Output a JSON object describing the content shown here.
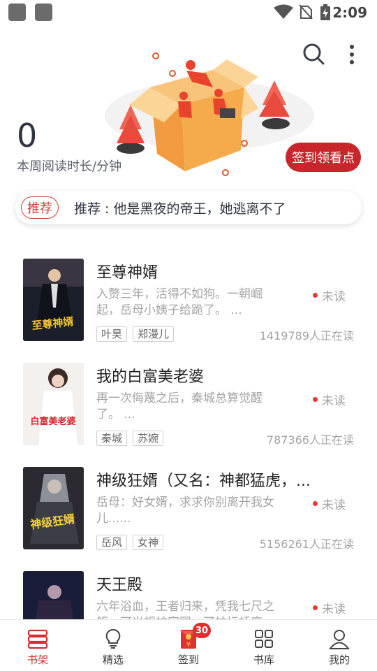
{
  "status_bar": {
    "time": "2:09"
  },
  "header": {
    "stat_value": "0",
    "stat_label": "本周阅读时长/分钟",
    "sign_button": "签到领看点"
  },
  "recommend": {
    "tag": "推荐",
    "text": "推荐 : 他是黑夜的帝王，她逃离不了"
  },
  "books": [
    {
      "title": "至尊神婿",
      "desc": "入赘三年，活得不如狗。一朝崛起，岳母小姨子给跪了。 ...",
      "status": "未读",
      "tags": [
        "叶昊",
        "郑漫儿"
      ],
      "readers": "1419789人正在读",
      "cover_text": "至尊神婿",
      "cover_bg": "#1b1f2a"
    },
    {
      "title": "我的白富美老婆",
      "desc": "再一次侮蔑之后，秦城总算觉醒了。 ...",
      "status": "未读",
      "tags": [
        "秦城",
        "苏婉"
      ],
      "readers": "787366人正在读",
      "cover_text": "白富美老婆",
      "cover_bg": "#f4f0ee"
    },
    {
      "title": "神级狂婿（又名：神都猛虎，...",
      "desc": "岳母：好女婿，求求你别离开我女儿......",
      "status": "未读",
      "tags": [
        "岳风",
        "女神"
      ],
      "readers": "5156261人正在读",
      "cover_text": "神级狂婿",
      "cover_bg": "#2a2a30"
    },
    {
      "title": "天王殿",
      "desc": "六年浴血，王者归来，凭我七尺之躯，可当规护家国，可护坛桥度。",
      "status": "未读",
      "tags": [],
      "readers": "",
      "cover_text": "",
      "cover_bg": "#1a1d3a"
    }
  ],
  "nav": [
    {
      "label": "书架",
      "icon": "bookshelf-icon",
      "active": true
    },
    {
      "label": "精选",
      "icon": "lightbulb-icon",
      "active": false
    },
    {
      "label": "签到",
      "icon": "red-envelope-icon",
      "active": false,
      "badge": "30"
    },
    {
      "label": "书库",
      "icon": "grid-icon",
      "active": false
    },
    {
      "label": "我的",
      "icon": "person-icon",
      "active": false
    }
  ],
  "colors": {
    "accent": "#c9262b",
    "unread_dot": "#e33c2c",
    "muted_text": "#a5a5a5"
  }
}
